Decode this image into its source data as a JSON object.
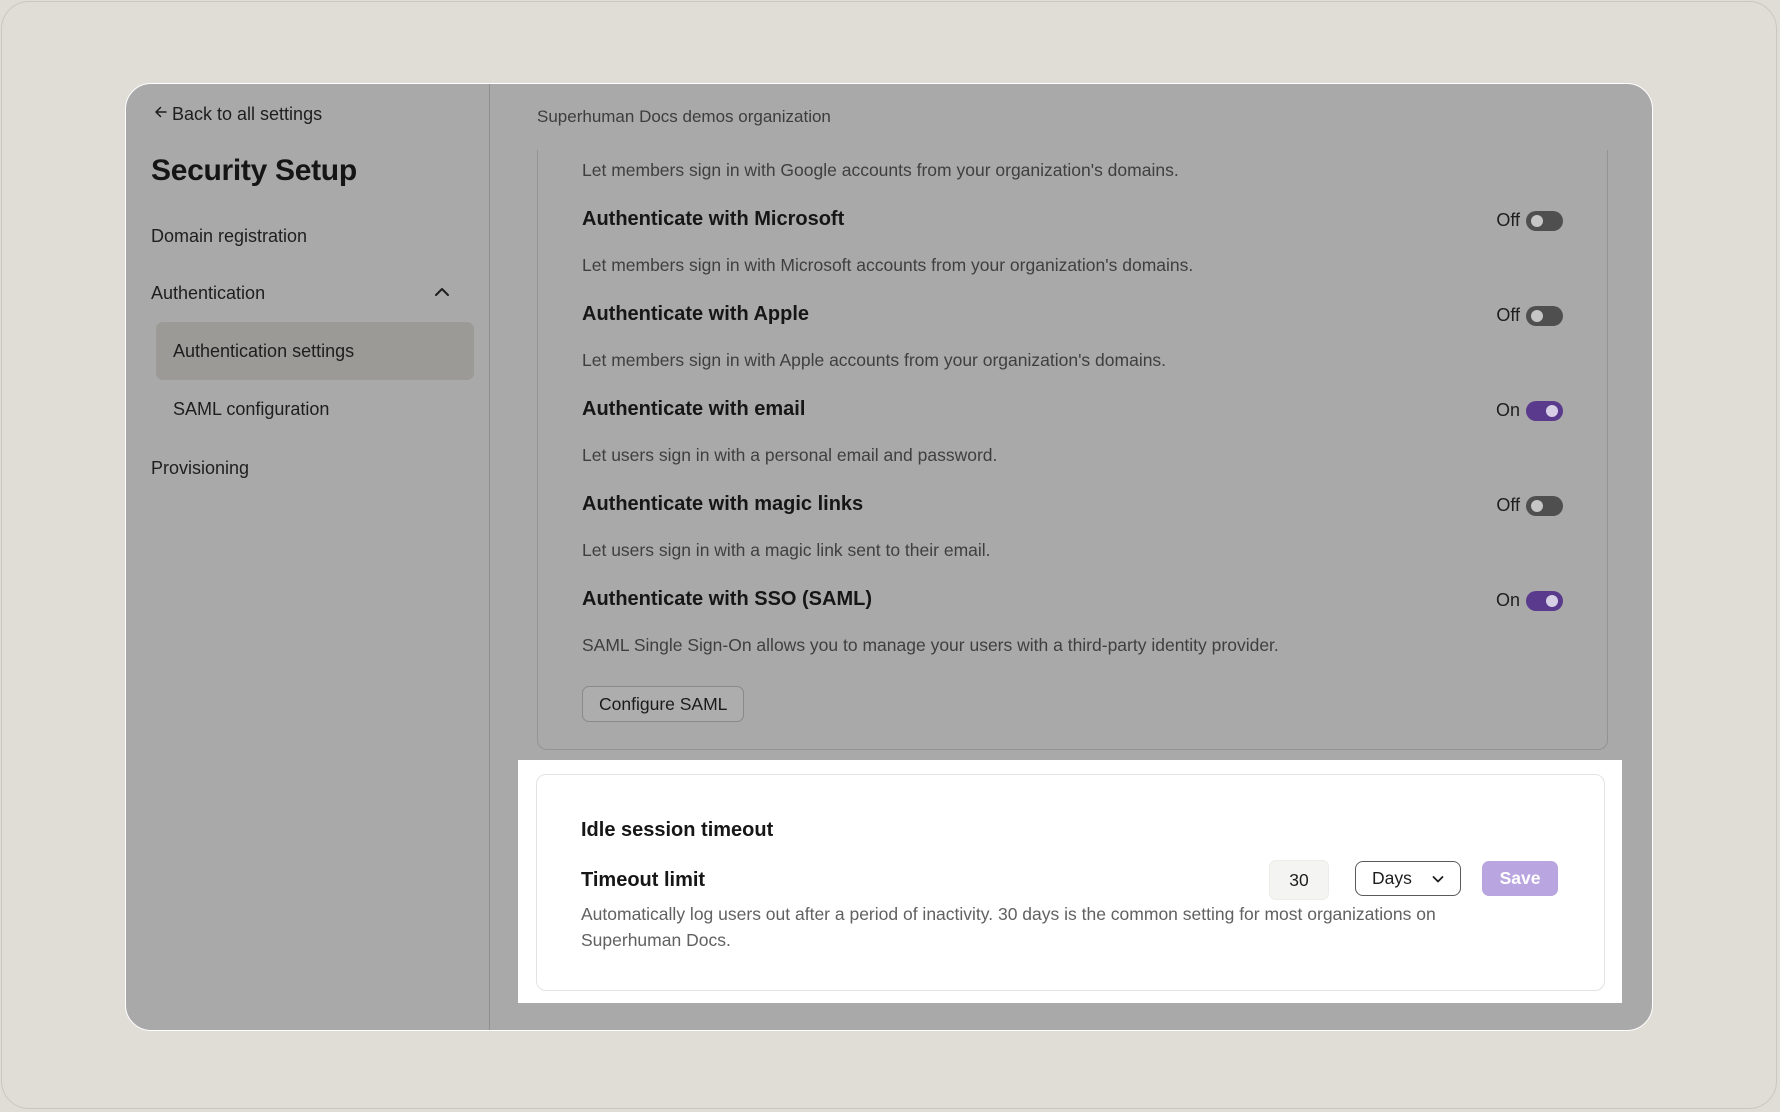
{
  "sidebar": {
    "back_label": "Back to all settings",
    "title": "Security Setup",
    "items": [
      {
        "label": "Domain registration"
      },
      {
        "label": "Authentication"
      },
      {
        "label": "Authentication settings"
      },
      {
        "label": "SAML configuration"
      },
      {
        "label": "Provisioning"
      }
    ]
  },
  "main": {
    "org_name": "Superhuman Docs demos organization",
    "google_desc": "Let members sign in with Google accounts from your organization's domains.",
    "settings": [
      {
        "title": "Authenticate with Microsoft",
        "desc": "Let members sign in with Microsoft accounts from your organization's domains.",
        "state_label": "Off",
        "on": false
      },
      {
        "title": "Authenticate with Apple",
        "desc": "Let members sign in with Apple accounts from your organization's domains.",
        "state_label": "Off",
        "on": false
      },
      {
        "title": "Authenticate with email",
        "desc": "Let users sign in with a personal email and password.",
        "state_label": "On",
        "on": true
      },
      {
        "title": "Authenticate with magic links",
        "desc": "Let users sign in with a magic link sent to their email.",
        "state_label": "Off",
        "on": false
      },
      {
        "title": "Authenticate with SSO (SAML)",
        "desc": "SAML Single Sign-On allows you to manage your users with a third-party identity provider.",
        "state_label": "On",
        "on": true
      }
    ],
    "configure_saml_label": "Configure SAML"
  },
  "timeout": {
    "heading": "Idle session timeout",
    "label": "Timeout limit",
    "value": "30",
    "unit": "Days",
    "save_label": "Save",
    "desc": "Automatically log users out after a period of inactivity. 30 days is the common setting for most organizations on Superhuman Docs."
  },
  "colors": {
    "toggle_on": "#5a3a8c",
    "toggle_off": "#4f4f4f",
    "save_button": "#b9a6e0",
    "overlay": "#a9a9a9"
  },
  "icons": {
    "back": "arrow-left-icon",
    "collapse": "chevron-up-icon",
    "dropdown": "chevron-down-icon"
  }
}
